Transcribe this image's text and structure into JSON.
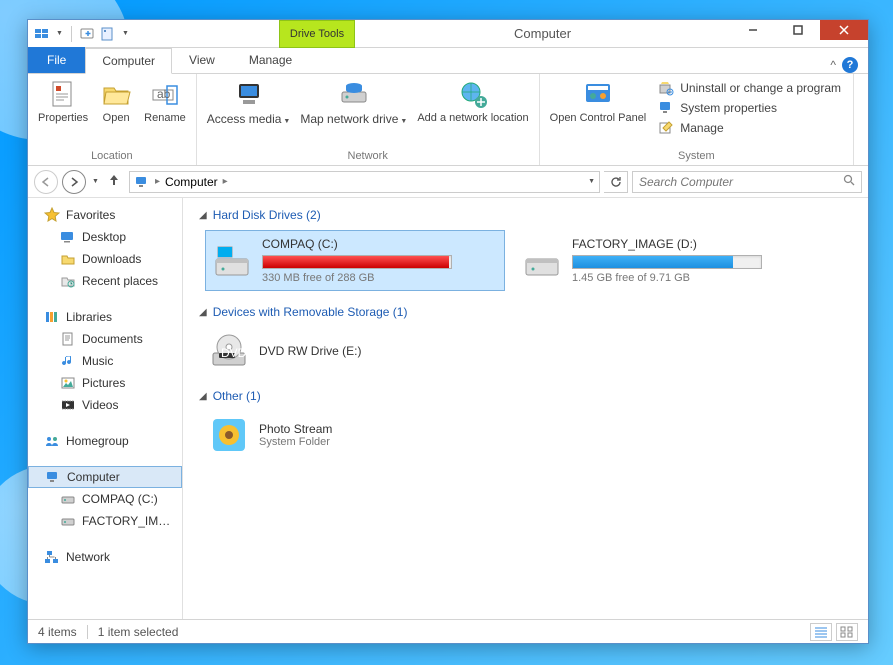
{
  "window": {
    "title": "Computer",
    "drive_tools_tab": "Drive Tools"
  },
  "tabs": {
    "file": "File",
    "computer": "Computer",
    "view": "View",
    "manage": "Manage"
  },
  "ribbon": {
    "location": {
      "label": "Location",
      "properties": "Properties",
      "open": "Open",
      "rename": "Rename"
    },
    "network": {
      "label": "Network",
      "access_media": "Access media",
      "map_drive": "Map network drive",
      "add_location": "Add a network location"
    },
    "control_panel": "Open Control Panel",
    "system": {
      "label": "System",
      "uninstall": "Uninstall or change a program",
      "sys_props": "System properties",
      "manage": "Manage"
    }
  },
  "breadcrumb": {
    "current": "Computer"
  },
  "search": {
    "placeholder": "Search Computer"
  },
  "sidebar": {
    "favorites": "Favorites",
    "fav_items": [
      "Desktop",
      "Downloads",
      "Recent places"
    ],
    "libraries": "Libraries",
    "lib_items": [
      "Documents",
      "Music",
      "Pictures",
      "Videos"
    ],
    "homegroup": "Homegroup",
    "computer": "Computer",
    "comp_items": [
      "COMPAQ (C:)",
      "FACTORY_IMAGE (D:)"
    ],
    "network": "Network"
  },
  "groups": {
    "hdd": {
      "title": "Hard Disk Drives (2)"
    },
    "removable": {
      "title": "Devices with Removable Storage (1)"
    },
    "other": {
      "title": "Other (1)"
    }
  },
  "drives": {
    "c": {
      "name": "COMPAQ (C:)",
      "free": "330 MB free of 288 GB",
      "fill_pct": 99
    },
    "d": {
      "name": "FACTORY_IMAGE (D:)",
      "free": "1.45 GB free of 9.71 GB",
      "fill_pct": 85
    }
  },
  "dvd": {
    "name": "DVD RW Drive (E:)"
  },
  "photo_stream": {
    "name": "Photo Stream",
    "sub": "System Folder"
  },
  "status": {
    "count": "4 items",
    "selected": "1 item selected"
  }
}
